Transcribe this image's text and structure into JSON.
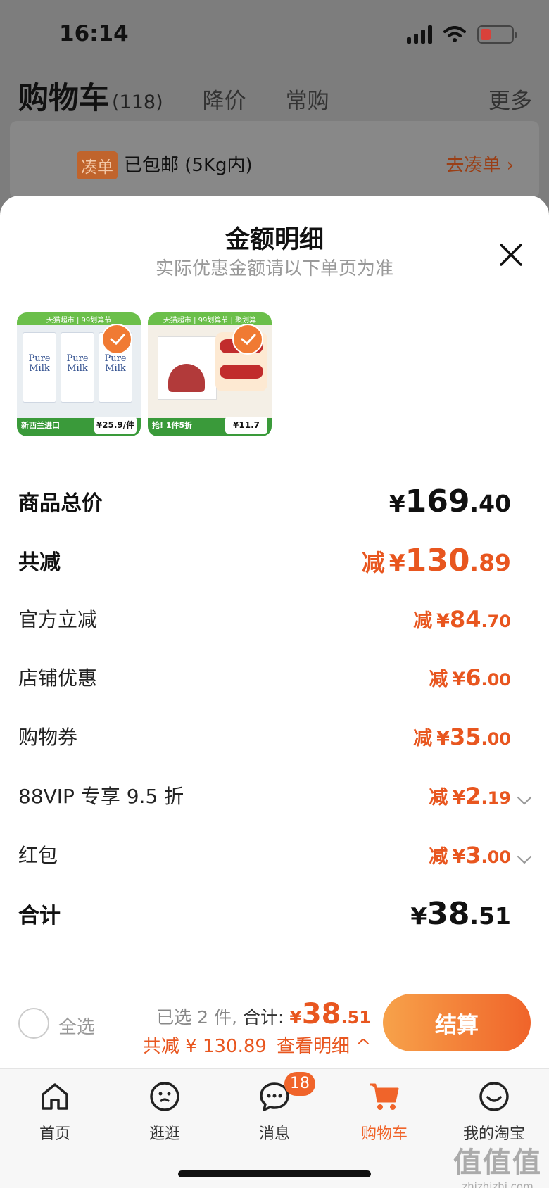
{
  "status_bar": {
    "time": "16:14"
  },
  "cart_header": {
    "title": "购物车",
    "count": "(118)",
    "tabs": [
      "降价",
      "常购"
    ],
    "more": "更多"
  },
  "bundle_bar": {
    "tag": "凑单",
    "text": "已包邮 (5Kg内)",
    "link": "去凑单 ›"
  },
  "sheet": {
    "title": "金额明细",
    "subtitle": "实际优惠金额请以下单页为准"
  },
  "products": [
    {
      "top_banner": "天猫超市 | 99划算节",
      "brand_text": "Pure Milk",
      "caption": "新西兰进口",
      "price": "¥25.9/件"
    },
    {
      "top_banner": "天猫超市 | 99划算节 | 聚划算",
      "caption": "抢! 1件5折",
      "price": "¥11.7"
    }
  ],
  "price_rows": [
    {
      "label": "商品总价",
      "prefix": "",
      "yen": "¥",
      "int": "169",
      "dec": ".40"
    },
    {
      "label": "共减",
      "prefix": "减",
      "yen": "¥",
      "int": "130",
      "dec": ".89"
    },
    {
      "label": "官方立减",
      "prefix": "减",
      "yen": "¥",
      "int": "84",
      "dec": ".70"
    },
    {
      "label": "店铺优惠",
      "prefix": "减",
      "yen": "¥",
      "int": "6",
      "dec": ".00"
    },
    {
      "label": "购物券",
      "prefix": "减",
      "yen": "¥",
      "int": "35",
      "dec": ".00"
    },
    {
      "label": "88VIP 专享 9.5 折",
      "prefix": "减",
      "yen": "¥",
      "int": "2",
      "dec": ".19"
    },
    {
      "label": "红包",
      "prefix": "减",
      "yen": "¥",
      "int": "3",
      "dec": ".00"
    },
    {
      "label": "合计",
      "prefix": "",
      "yen": "¥",
      "int": "38",
      "dec": ".51"
    }
  ],
  "checkout": {
    "select_all": "全选",
    "selected_count": "已选 2 件,",
    "total_label": "合计:",
    "total_yen": "¥",
    "total_int": "38",
    "total_dec": ".51",
    "discount_label": "共减 ¥ 130.89",
    "detail_link": "查看明细 ^",
    "button": "结算"
  },
  "tab_bar": {
    "items": [
      {
        "label": "首页",
        "icon": "home-icon"
      },
      {
        "label": "逛逛",
        "icon": "browse-icon"
      },
      {
        "label": "消息",
        "icon": "message-icon",
        "badge": "18"
      },
      {
        "label": "购物车",
        "icon": "cart-icon"
      },
      {
        "label": "我的淘宝",
        "icon": "profile-icon"
      }
    ],
    "active_index": 3
  },
  "watermark": {
    "logo": "值值值",
    "site": "zhizhizhi.com"
  },
  "colors": {
    "accent": "#f0642a",
    "price_red": "#e8561f"
  }
}
